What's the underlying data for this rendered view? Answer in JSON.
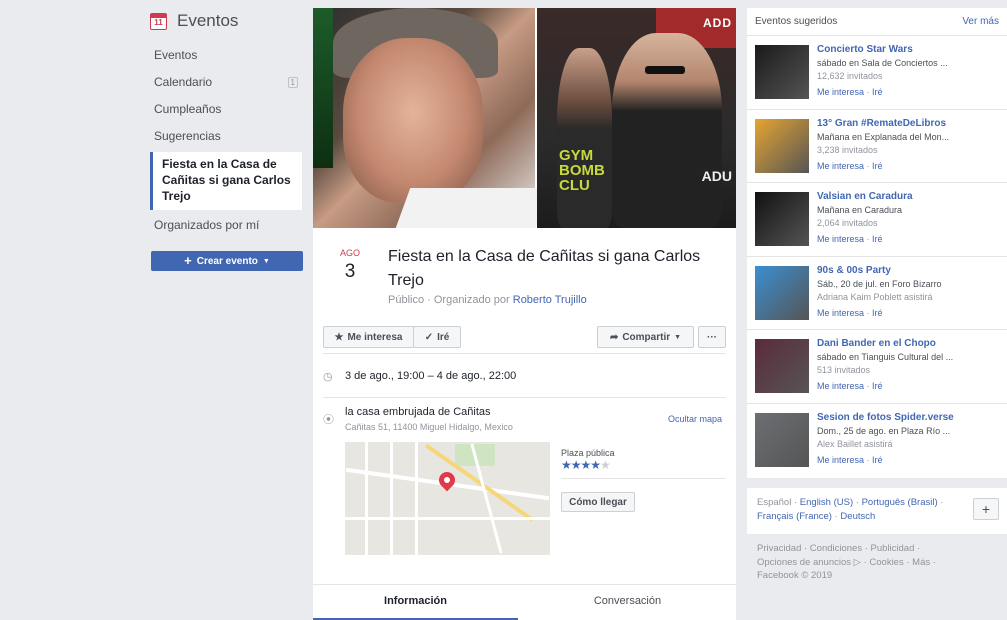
{
  "sidebar": {
    "title": "Eventos",
    "items": [
      {
        "label": "Eventos"
      },
      {
        "label": "Calendario",
        "count": "1"
      },
      {
        "label": "Cumpleaños"
      },
      {
        "label": "Sugerencias"
      },
      {
        "label": "Fiesta en la Casa de Cañitas si gana Carlos Trejo"
      },
      {
        "label": "Organizados por mí"
      }
    ],
    "create_button": "Crear evento"
  },
  "cover": {
    "sign_text": "ADD",
    "shirt_text": "GYM\nBOMB\nCLU",
    "side_text": "ADU"
  },
  "event": {
    "month": "AGO",
    "day": "3",
    "title": "Fiesta en la Casa de Cañitas si gana Carlos Trejo",
    "privacy": "Público",
    "organized_by_label": "Organizado por",
    "organizer": "Roberto Trujillo",
    "actions": {
      "interest": "Me interesa",
      "going": "Iré",
      "share": "Compartir",
      "more": "···"
    },
    "time": "3 de ago., 19:00 – 4 de ago., 22:00",
    "location_name": "la casa embrujada de Cañitas",
    "location_address": "Cañitas 51, 11400 Miguel Hidalgo, Mexico",
    "hide_map": "Ocultar mapa",
    "place_type": "Plaza pública",
    "rating": 4,
    "directions": "Cómo llegar",
    "tabs": [
      "Información",
      "Conversación"
    ]
  },
  "suggested": {
    "title": "Eventos sugeridos",
    "see_more": "Ver más",
    "items": [
      {
        "title": "Concierto Star Wars",
        "line1": "sábado en Sala de Conciertos ...",
        "line2": "12,632 invitados",
        "thumb": "#1a1a1a"
      },
      {
        "title": "13° Gran #RemateDeLibros",
        "line1": "Mañana en Explanada del Mon...",
        "line2": "3,238 invitados",
        "thumb": "#e6a531"
      },
      {
        "title": "Valsian en Caradura",
        "line1": "Mañana en Caradura",
        "line2": "2,064 invitados",
        "thumb": "#111111"
      },
      {
        "title": "90s & 00s Party",
        "line1": "Sáb., 20 de jul. en Foro Bizarro",
        "line2": "Adriana Kaim Poblett asistirá",
        "thumb": "#3b8fd1"
      },
      {
        "title": "Dani Bander en el Chopo",
        "line1": "sábado en Tianguis Cultural del ...",
        "line2": "513 invitados",
        "thumb": "#5b2b3a"
      },
      {
        "title": "Sesion de fotos Spider.verse",
        "line1": "Dom., 25 de ago. en Plaza Río ...",
        "line2": "Alex Baillet asistirá",
        "thumb": "#6c6f73"
      }
    ],
    "interest_label": "Me interesa",
    "going_label": "Iré"
  },
  "languages": {
    "current": "Español",
    "others": [
      "English (US)",
      "Português (Brasil)",
      "Français (France)",
      "Deutsch"
    ],
    "plus": "+"
  },
  "footer": {
    "line1": "Privacidad · Condiciones · Publicidad ·",
    "line2": "Opciones de anuncios ▷ · Cookies · Más ·",
    "line3": "Facebook © 2019"
  }
}
